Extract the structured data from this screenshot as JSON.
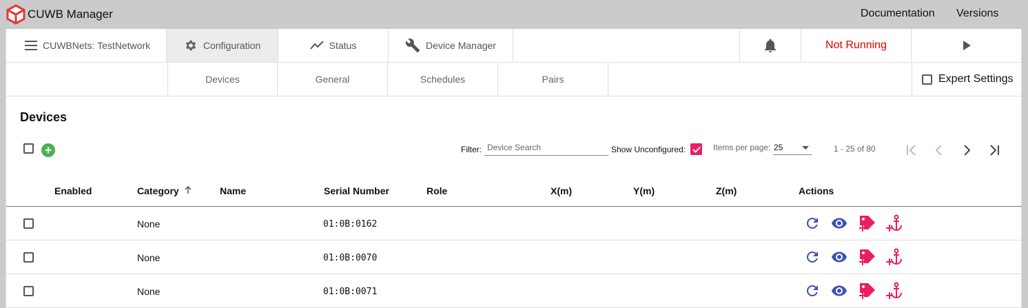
{
  "app": {
    "title": "CUWB Manager",
    "links": [
      "Documentation",
      "Versions"
    ]
  },
  "nav": {
    "network": "CUWBNets: TestNetwork",
    "configuration": "Configuration",
    "status": "Status",
    "device_manager": "Device Manager",
    "run_status": "Not Running",
    "run_status_color": "#e00000"
  },
  "subnav": {
    "tabs": [
      "Devices",
      "General",
      "Schedules",
      "Pairs"
    ],
    "active": "Devices",
    "expert_settings": "Expert Settings"
  },
  "devices": {
    "title": "Devices",
    "filter_label": "Filter:",
    "search_placeholder": "Device Search",
    "show_unconfigured_label": "Show Unconfigured:",
    "show_unconfigured": true,
    "items_per_page_label": "Items per page:",
    "items_per_page": "25",
    "range": "1 - 25 of 80",
    "columns": [
      "Enabled",
      "Category",
      "Name",
      "Serial Number",
      "Role",
      "X(m)",
      "Y(m)",
      "Z(m)",
      "Actions"
    ],
    "sort_column": "Category",
    "rows": [
      {
        "category": "None",
        "serial": "01:0B:0162"
      },
      {
        "category": "None",
        "serial": "01:0B:0070"
      },
      {
        "category": "None",
        "serial": "01:0B:0071"
      }
    ]
  },
  "colors": {
    "accent": "#3f51b5",
    "pink": "#e91e63",
    "add_green": "#4caf50",
    "action_blue": "#3f51b5"
  }
}
